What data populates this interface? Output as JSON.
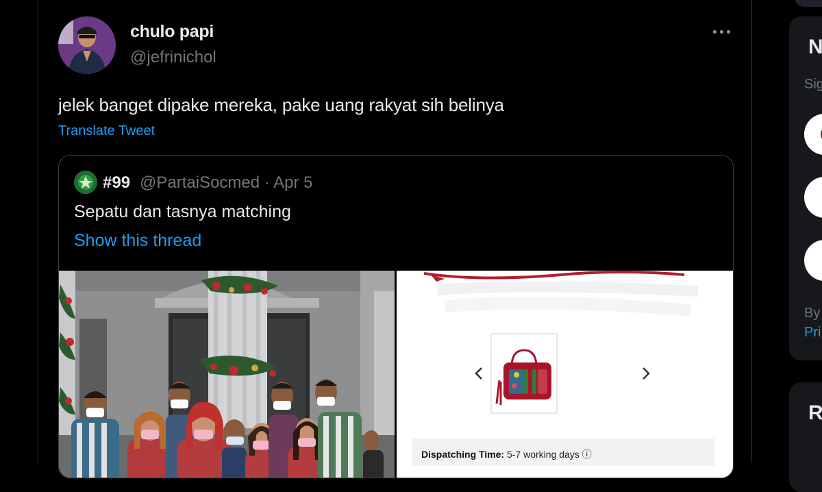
{
  "tweet": {
    "display_name": "chulo papi",
    "handle": "@jefrinichol",
    "text": "jelek banget dipake mereka, pake uang rakyat sih belinya",
    "translate_label": "Translate Tweet"
  },
  "quoted": {
    "name": "#99",
    "meta": "@PartaiSocmed · Apr 5",
    "text": "Sepatu dan tasnya matching",
    "thread_label": "Show this thread"
  },
  "product_image": {
    "dispatch_label": "Dispatching Time:",
    "dispatch_value": "5-7 working days"
  },
  "sidebar": {
    "title_partial": "N",
    "subtitle_partial": "Sig",
    "by_partial": "By",
    "link_partial": "Pri",
    "title2_partial": "R"
  },
  "colors": {
    "accent": "#1d9bf0",
    "background": "#000000",
    "muted": "#71767b",
    "text": "#e7e9ea"
  }
}
